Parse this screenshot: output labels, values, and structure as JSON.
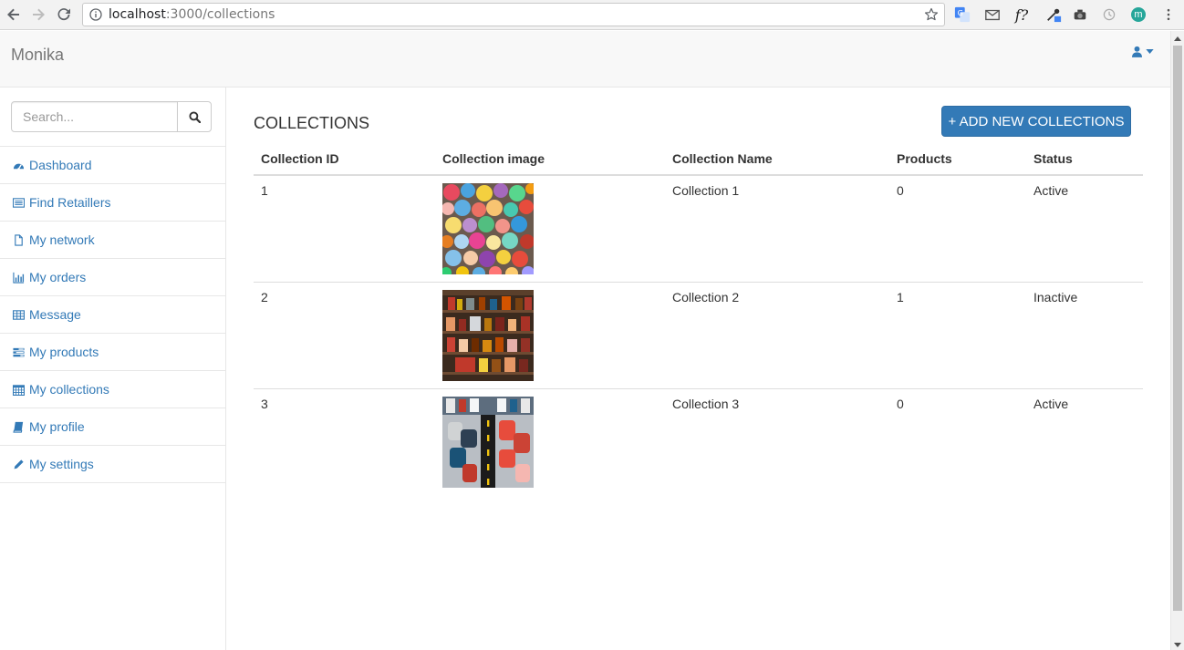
{
  "browser": {
    "url_host": "localhost",
    "url_rest": ":3000/collections",
    "icons": [
      "back-icon",
      "forward-icon",
      "reload-icon",
      "info-icon",
      "star-icon",
      "translate-icon",
      "gmail-icon",
      "formula-icon",
      "eyedropper-icon",
      "camera-icon",
      "clock-icon",
      "profile-icon",
      "more-icon"
    ],
    "profile_initial": "m"
  },
  "header": {
    "brand": "Monika",
    "user_icon": "user-icon"
  },
  "sidebar": {
    "search_placeholder": "Search...",
    "items": [
      {
        "label": "Dashboard",
        "icon": "dashboard-icon"
      },
      {
        "label": "Find Retaillers",
        "icon": "list-icon"
      },
      {
        "label": "My network",
        "icon": "file-icon"
      },
      {
        "label": "My orders",
        "icon": "bar-chart-icon"
      },
      {
        "label": "Message",
        "icon": "table-icon"
      },
      {
        "label": "My products",
        "icon": "tasks-icon"
      },
      {
        "label": "My collections",
        "icon": "calendar-icon"
      },
      {
        "label": "My profile",
        "icon": "book-icon"
      },
      {
        "label": "My settings",
        "icon": "pencil-icon"
      }
    ]
  },
  "main": {
    "title": "COLLECTIONS",
    "add_button": "+ ADD NEW COLLECTIONS",
    "columns": [
      "Collection ID",
      "Collection image",
      "Collection Name",
      "Products",
      "Status"
    ],
    "rows": [
      {
        "id": "1",
        "name": "Collection 1",
        "products": "0",
        "status": "Active",
        "image": "colorful-balls-image"
      },
      {
        "id": "2",
        "name": "Collection 2",
        "products": "1",
        "status": "Inactive",
        "image": "shelves-image"
      },
      {
        "id": "3",
        "name": "Collection 3",
        "products": "0",
        "status": "Active",
        "image": "toy-cars-image"
      }
    ]
  },
  "colors": {
    "accent": "#337ab7",
    "header_bg": "#f8f8f8"
  }
}
